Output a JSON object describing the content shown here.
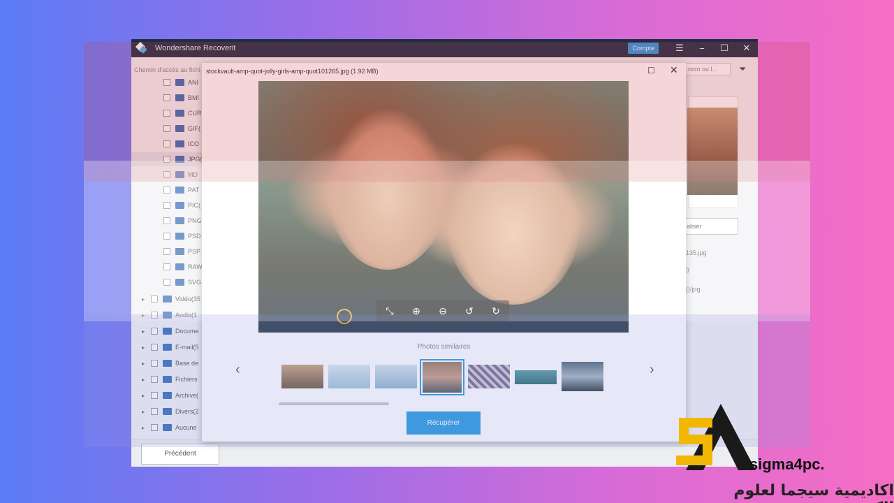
{
  "app": {
    "title": "Wondershare Recoverit",
    "account_label": "Compte",
    "path_label": "Chemin d'accès au fichi",
    "search_placeholder": "nom ou l...",
    "prev_label": "Précédent",
    "right_button_label": "aliser",
    "right_info": [
      "135.jpg",
      "3",
      "()/jpg"
    ]
  },
  "tree": {
    "image_types": [
      "ANI",
      "BMI",
      "CUR",
      "GIF(",
      "ICO",
      "JPG(",
      "MD",
      "PAT",
      "PIC(",
      "PNG",
      "PSD",
      "PSP",
      "RAW",
      "SVG"
    ],
    "categories": [
      "Vidéo(35",
      "Audio(1",
      "Docume",
      "E-mail(5",
      "Base de",
      "Fichiers",
      "Archive(",
      "Divers(2",
      "Aucune"
    ]
  },
  "dialog": {
    "filename": "stockvault-amp-quot-jolly-girls-amp-quot101265.jpg (1.92 MB)",
    "similar_label": "Photos similaires",
    "recover_label": "Récupérer",
    "controls": [
      "fit-icon",
      "zoom-in-icon",
      "zoom-out-icon",
      "rotate-left-icon",
      "rotate-right-icon"
    ]
  },
  "watermark": {
    "site": "sigma4pc.",
    "arabic": "اكاديمية سيجما لعلوم الكمبيوتر"
  },
  "colors": {
    "accent": "#2a9ae0",
    "titlebar": "#1f2d44"
  }
}
